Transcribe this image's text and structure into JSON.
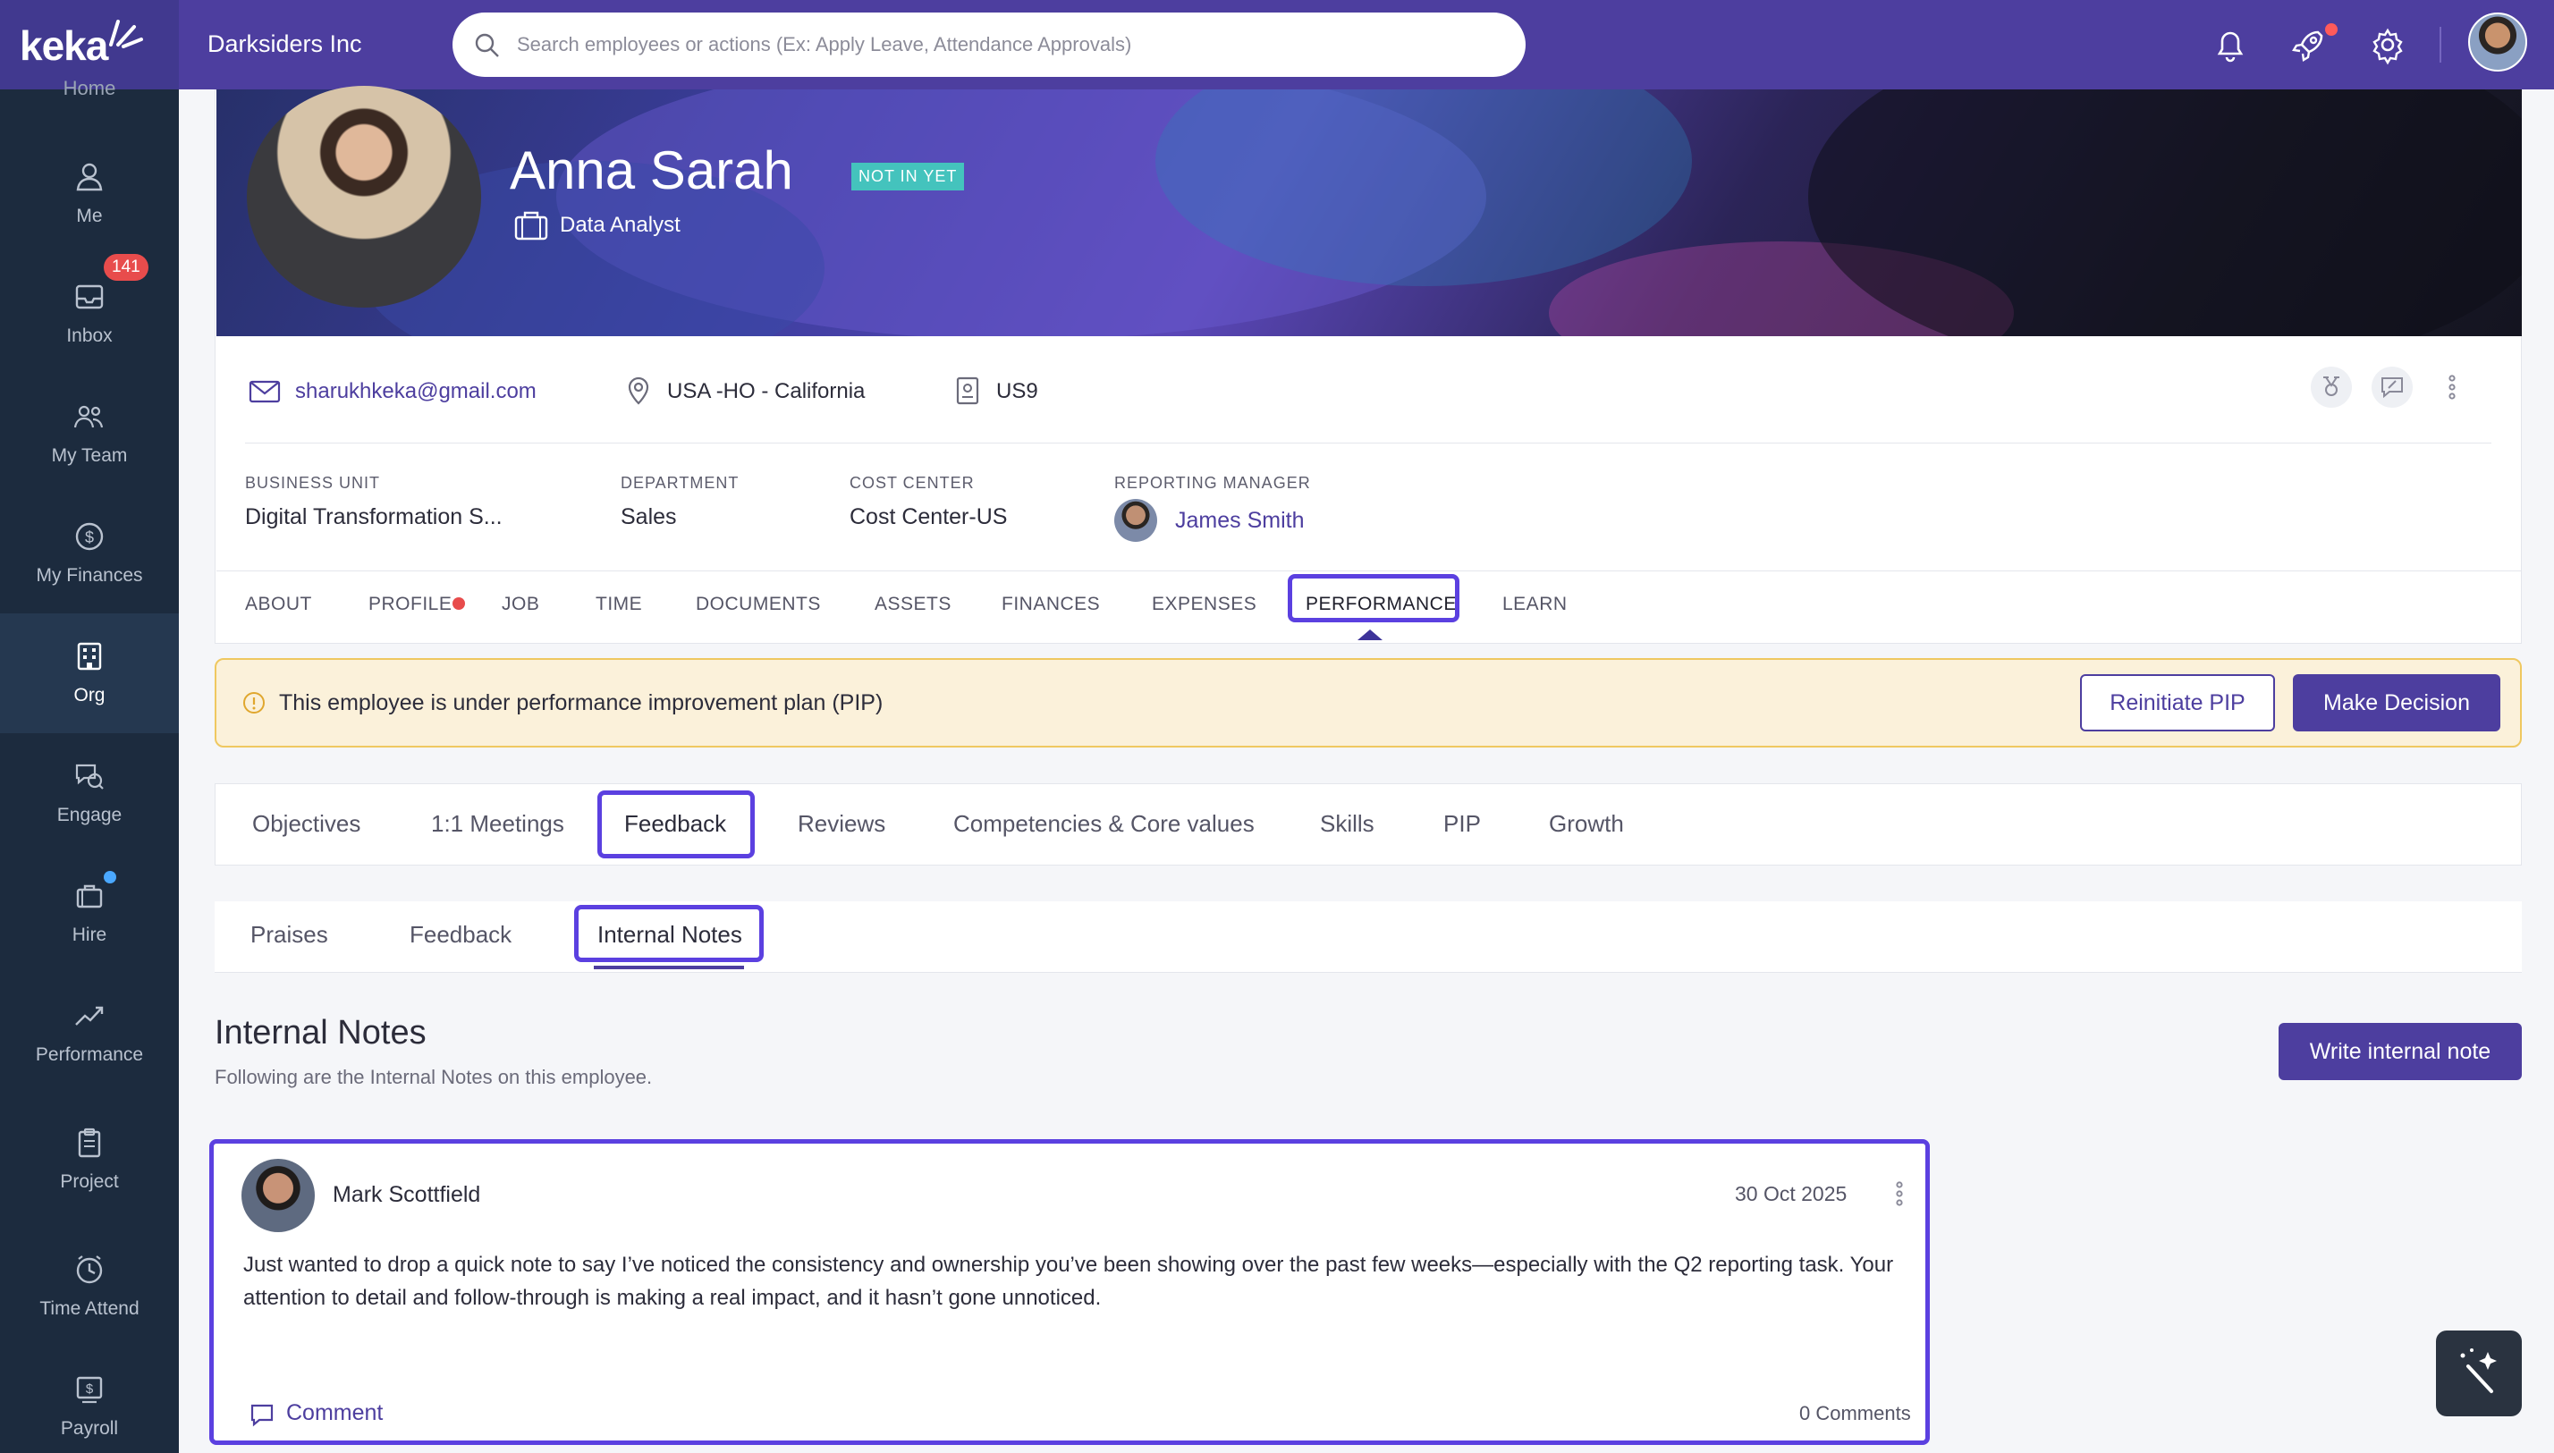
{
  "app": {
    "logo": "keka",
    "company": "Darksiders Inc"
  },
  "search": {
    "placeholder": "Search employees or actions (Ex: Apply Leave, Attendance Approvals)"
  },
  "sidebar": {
    "home_label": "Home",
    "items": [
      {
        "label": "Me",
        "icon": "person-icon"
      },
      {
        "label": "Inbox",
        "icon": "inbox-icon",
        "badge": "141"
      },
      {
        "label": "My Team",
        "icon": "team-icon"
      },
      {
        "label": "My Finances",
        "icon": "dollar-icon"
      },
      {
        "label": "Org",
        "icon": "building-icon",
        "active": true
      },
      {
        "label": "Engage",
        "icon": "chat-icon"
      },
      {
        "label": "Hire",
        "icon": "briefcase-icon"
      },
      {
        "label": "Performance",
        "icon": "trend-icon"
      },
      {
        "label": "Project",
        "icon": "clipboard-icon"
      },
      {
        "label": "Time Attend",
        "icon": "clock-icon"
      },
      {
        "label": "Payroll",
        "icon": "payroll-icon"
      }
    ]
  },
  "employee": {
    "name": "Anna Sarah",
    "status": "NOT IN YET",
    "designation": "Data Analyst",
    "email": "sharukhkeka@gmail.com",
    "location": "USA -HO - California",
    "emp_id": "US9",
    "business_unit_label": "BUSINESS UNIT",
    "business_unit": "Digital Transformation S...",
    "department_label": "DEPARTMENT",
    "department": "Sales",
    "cost_center_label": "COST CENTER",
    "cost_center": "Cost Center-US",
    "manager_label": "REPORTING MANAGER",
    "manager": "James Smith"
  },
  "tabs": [
    "ABOUT",
    "PROFILE",
    "JOB",
    "TIME",
    "DOCUMENTS",
    "ASSETS",
    "FINANCES",
    "EXPENSES",
    "PERFORMANCE",
    "LEARN"
  ],
  "pip": {
    "message": "This employee is under performance improvement plan (PIP)",
    "reinitiate": "Reinitiate PIP",
    "decision": "Make Decision"
  },
  "perf_tabs": [
    "Objectives",
    "1:1 Meetings",
    "Feedback",
    "Reviews",
    "Competencies & Core values",
    "Skills",
    "PIP",
    "Growth"
  ],
  "feedback_tabs": [
    "Praises",
    "Feedback",
    "Internal Notes"
  ],
  "section": {
    "title": "Internal Notes",
    "subtitle": "Following are the Internal Notes on this employee.",
    "write_button": "Write internal note"
  },
  "note": {
    "author": "Mark Scottfield",
    "date": "30 Oct 2025",
    "body": "Just wanted to drop a quick note to say I’ve noticed the consistency and ownership you’ve been showing over the past few weeks—especially with the Q2 reporting task. Your attention to detail and follow-through is making a real impact, and it hasn’t gone unnoticed.",
    "comment_label": "Comment",
    "comment_count": "0 Comments"
  },
  "colors": {
    "brand": "#4d3e9f",
    "sidebar": "#1c2b3e",
    "highlight": "#5b40e0",
    "pip_bg": "#fbf1da"
  }
}
